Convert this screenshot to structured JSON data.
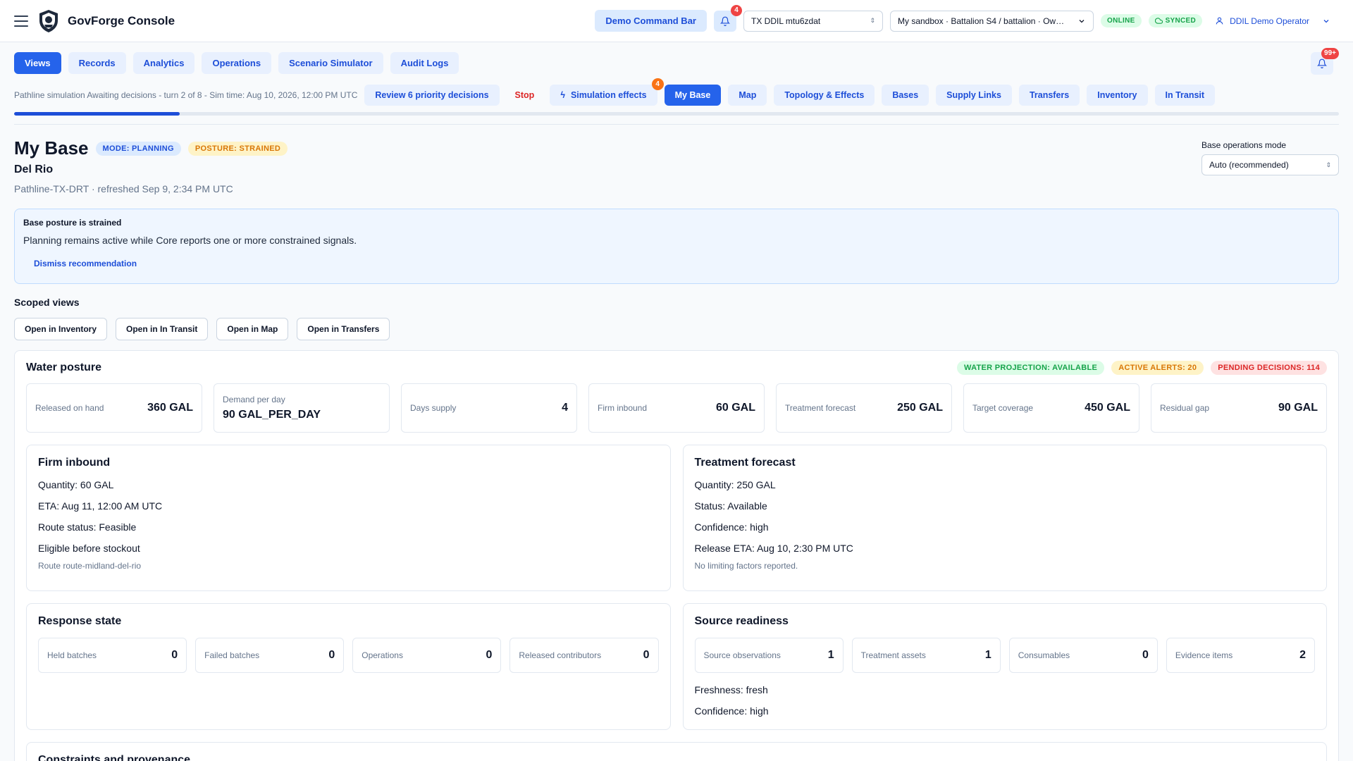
{
  "app": {
    "brand": "GovForge Console",
    "command_bar_label": "Demo Command Bar",
    "notifications_count": "4",
    "tenant_select": "TX DDIL mtu6zdat",
    "sandbox_select": "My sandbox · Battalion S4 / battalion · Ow…",
    "status_online": "ONLINE",
    "status_synced": "SYNCED",
    "user_name": "DDIL Demo Operator"
  },
  "nav": {
    "tabs": [
      {
        "label": "Views",
        "active": true
      },
      {
        "label": "Records",
        "active": false
      },
      {
        "label": "Analytics",
        "active": false
      },
      {
        "label": "Operations",
        "active": false
      },
      {
        "label": "Scenario Simulator",
        "active": false
      },
      {
        "label": "Audit Logs",
        "active": false
      }
    ],
    "alerts_count": "99+"
  },
  "sim": {
    "status_text": "Pathline simulation Awaiting decisions - turn 2 of 8 - Sim time: Aug 10, 2026, 12:00 PM UTC",
    "review_label": "Review 6 priority decisions",
    "stop_label": "Stop",
    "effects_label": "Simulation effects",
    "effects_count": "4",
    "progress_fraction": 0.125,
    "view_tabs": [
      {
        "label": "My Base",
        "active": true
      },
      {
        "label": "Map",
        "active": false
      },
      {
        "label": "Topology & Effects",
        "active": false
      },
      {
        "label": "Bases",
        "active": false
      },
      {
        "label": "Supply Links",
        "active": false
      },
      {
        "label": "Transfers",
        "active": false
      },
      {
        "label": "Inventory",
        "active": false
      },
      {
        "label": "In Transit",
        "active": false
      }
    ]
  },
  "page": {
    "title": "My Base",
    "mode_tag": "MODE: PLANNING",
    "posture_tag": "POSTURE: STRAINED",
    "site": "Del Rio",
    "subline": "Pathline-TX-DRT · refreshed Sep 9, 2:34 PM UTC",
    "ops_mode_label": "Base operations mode",
    "ops_mode_value": "Auto (recommended)"
  },
  "alert": {
    "title": "Base posture is strained",
    "body": "Planning remains active while Core reports one or more constrained signals.",
    "dismiss_label": "Dismiss recommendation"
  },
  "scoped": {
    "title": "Scoped views",
    "buttons": [
      "Open in Inventory",
      "Open in In Transit",
      "Open in Map",
      "Open in Transfers"
    ]
  },
  "water": {
    "title": "Water posture",
    "tags": [
      "WATER PROJECTION: AVAILABLE",
      "ACTIVE ALERTS: 20",
      "PENDING DECISIONS: 114"
    ],
    "metrics": [
      {
        "label": "Released on hand",
        "value": "360 GAL"
      },
      {
        "label": "Demand per day",
        "value": "90 GAL_PER_DAY"
      },
      {
        "label": "Days supply",
        "value": "4"
      },
      {
        "label": "Firm inbound",
        "value": "60 GAL"
      },
      {
        "label": "Treatment forecast",
        "value": "250 GAL"
      },
      {
        "label": "Target coverage",
        "value": "450 GAL"
      },
      {
        "label": "Residual gap",
        "value": "90 GAL"
      }
    ],
    "firm_inbound": {
      "title": "Firm inbound",
      "lines": [
        "Quantity: 60 GAL",
        "ETA: Aug 11, 12:00 AM UTC",
        "Route status: Feasible",
        "Eligible before stockout"
      ],
      "note": "Route route-midland-del-rio"
    },
    "treatment": {
      "title": "Treatment forecast",
      "lines": [
        "Quantity: 250 GAL",
        "Status: Available",
        "Confidence: high",
        "Release ETA: Aug 10, 2:30 PM UTC"
      ],
      "note": "No limiting factors reported."
    },
    "response": {
      "title": "Response state",
      "items": [
        {
          "label": "Held batches",
          "value": "0"
        },
        {
          "label": "Failed batches",
          "value": "0"
        },
        {
          "label": "Operations",
          "value": "0"
        },
        {
          "label": "Released contributors",
          "value": "0"
        }
      ]
    },
    "source": {
      "title": "Source readiness",
      "items": [
        {
          "label": "Source observations",
          "value": "1"
        },
        {
          "label": "Treatment assets",
          "value": "1"
        },
        {
          "label": "Consumables",
          "value": "0"
        },
        {
          "label": "Evidence items",
          "value": "2"
        }
      ],
      "lines": [
        "Freshness: fresh",
        "Confidence: high"
      ]
    },
    "constraints_title": "Constraints and provenance"
  }
}
